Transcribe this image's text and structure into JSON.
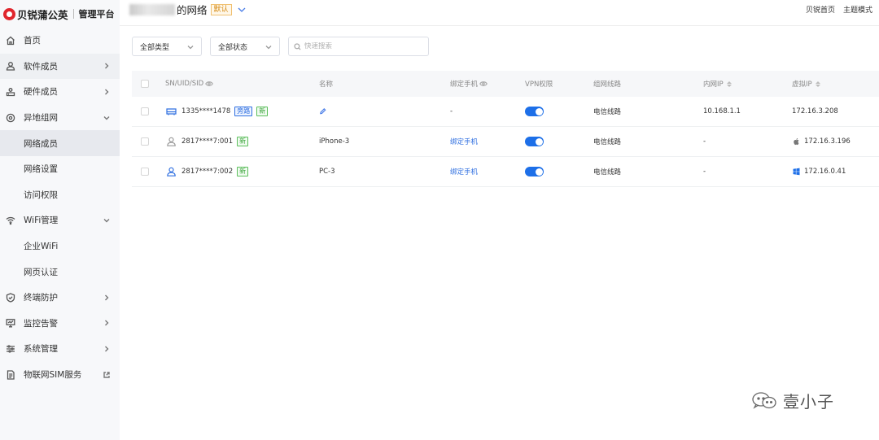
{
  "brand": {
    "name": "贝锐蒲公英",
    "subtitle": "管理平台"
  },
  "header": {
    "network_title_suffix": "的网络",
    "default_badge": "默认",
    "links": [
      "贝锐首页",
      "主题模式"
    ]
  },
  "sidebar": {
    "items": [
      {
        "label": "首页",
        "icon": "home-icon"
      },
      {
        "label": "软件成员",
        "icon": "user-icon"
      },
      {
        "label": "硬件成员",
        "icon": "router-icon"
      },
      {
        "label": "异地组网",
        "icon": "network-icon"
      },
      {
        "label": "网络成员"
      },
      {
        "label": "网络设置"
      },
      {
        "label": "访问权限"
      },
      {
        "label": "WiFi管理",
        "icon": "wifi-icon"
      },
      {
        "label": "企业WiFi"
      },
      {
        "label": "网页认证"
      },
      {
        "label": "终端防护",
        "icon": "shield-icon"
      },
      {
        "label": "监控告警",
        "icon": "monitor-icon"
      },
      {
        "label": "系统管理",
        "icon": "settings-sliders-icon"
      },
      {
        "label": "物联网SIM服务",
        "icon": "sim-card-icon"
      }
    ]
  },
  "filters": {
    "type_select": "全部类型",
    "status_select": "全部状态",
    "search_placeholder": "快速搜索"
  },
  "table": {
    "headers": {
      "sn": "SN/UID/SID",
      "name": "名称",
      "phone": "绑定手机",
      "vpn": "VPN权限",
      "line": "组网线路",
      "ip": "内网IP",
      "vip": "虚拟IP"
    },
    "rows": [
      {
        "sn": "1335****1478",
        "device_icon": "router-device-icon",
        "tags": [
          "旁路",
          "新"
        ],
        "name": "",
        "phone": "-",
        "vpn_enabled": true,
        "line": "电信线路",
        "ip": "10.168.1.1",
        "vip_os": "",
        "vip": "172.16.3.208"
      },
      {
        "sn": "2817****7:001",
        "device_icon": "user-outline-icon",
        "tags": [
          "新"
        ],
        "name": "iPhone-3",
        "phone": "绑定手机",
        "vpn_enabled": true,
        "line": "电信线路",
        "ip": "-",
        "vip_os": "apple-icon",
        "vip": "172.16.3.196"
      },
      {
        "sn": "2817****7:002",
        "device_icon": "user-blue-icon",
        "tags": [
          "新"
        ],
        "name": "PC-3",
        "phone": "绑定手机",
        "vpn_enabled": true,
        "line": "电信线路",
        "ip": "-",
        "vip_os": "windows-icon",
        "vip": "172.16.0.41"
      }
    ]
  },
  "watermark": {
    "text": "壹小子",
    "icon": "wechat-icon"
  },
  "colors": {
    "accent": "#1d6fe8",
    "brand_red": "#e0262d",
    "badge_orange": "#d58a14",
    "tag_green": "#3da53d"
  }
}
